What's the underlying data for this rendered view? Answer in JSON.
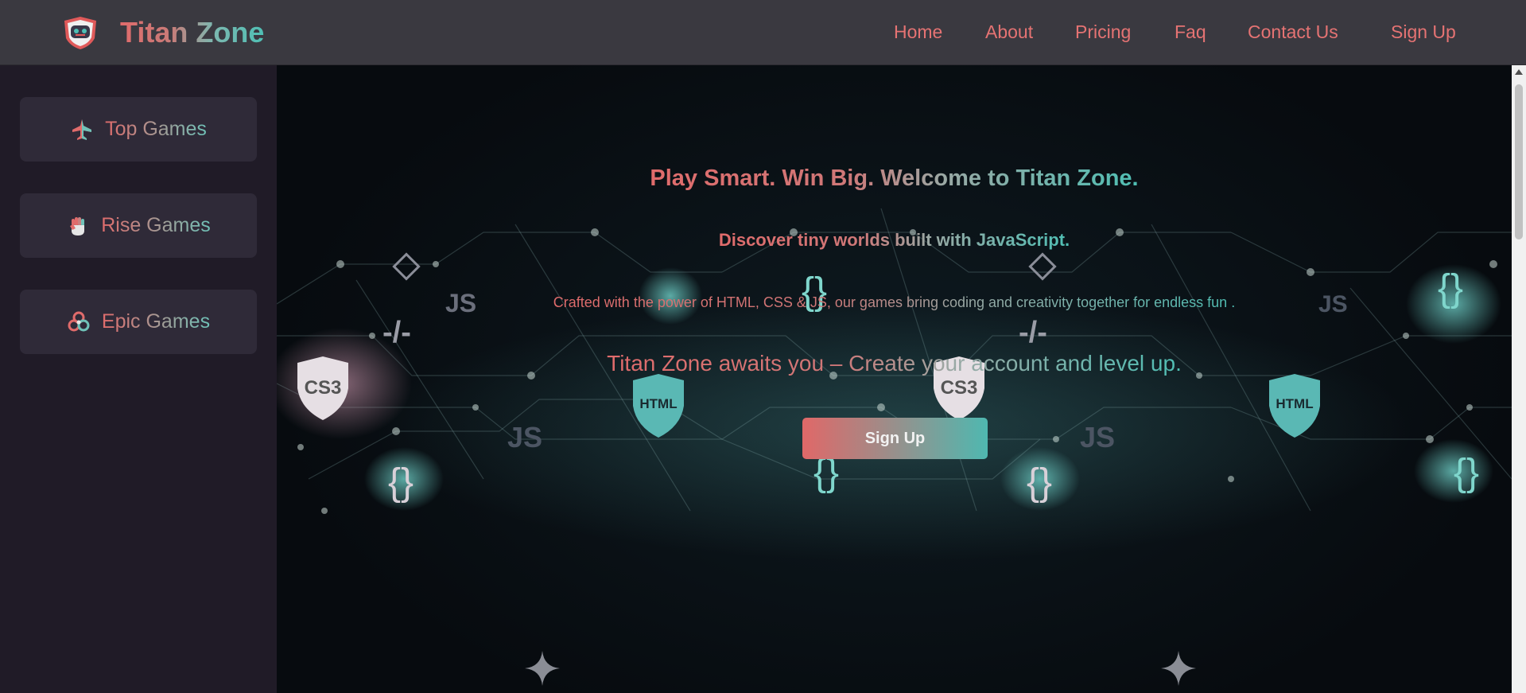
{
  "brand": {
    "name": "Titan Zone",
    "logo_icon": "robot-helmet-icon"
  },
  "nav": {
    "items": [
      "Home",
      "About",
      "Pricing",
      "Faq",
      "Contact Us"
    ],
    "signup": "Sign Up"
  },
  "sidebar": {
    "items": [
      {
        "label": "Top Games",
        "icon": "jet-icon"
      },
      {
        "label": "Rise Games",
        "icon": "fist-icon"
      },
      {
        "label": "Epic Games",
        "icon": "biohazard-icon"
      }
    ]
  },
  "hero": {
    "headline": "Play Smart. Win Big. Welcome to Titan Zone.",
    "subheadline": "Discover tiny worlds built with JavaScript.",
    "description": "Crafted with the power of HTML, CSS & JS, our games bring coding and creativity together for endless fun .",
    "tagline": "Titan Zone awaits you – Create your account and level up.",
    "cta": "Sign Up",
    "background_labels": {
      "css": "CS3",
      "html": "HTML",
      "js": "JS",
      "braces": "{}",
      "slash": "-/-"
    }
  },
  "colors": {
    "accent_red": "#e06b6b",
    "accent_teal": "#4fbfb4",
    "header_bg": "#3a3940",
    "sidebar_bg": "#201b27"
  }
}
